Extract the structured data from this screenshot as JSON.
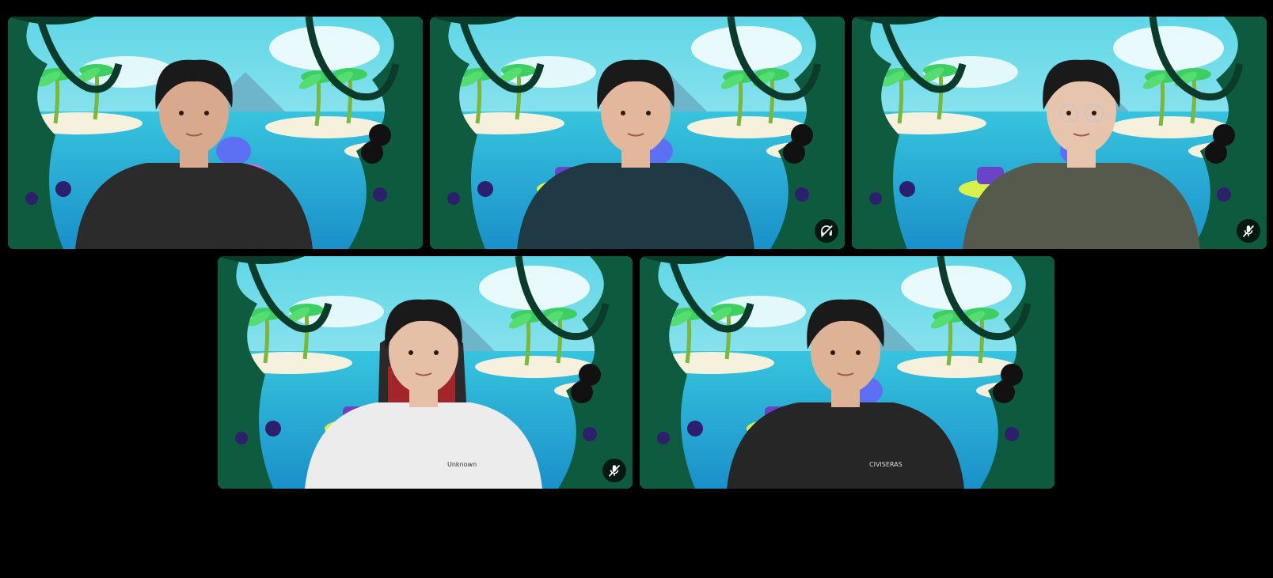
{
  "call": {
    "tiles": [
      {
        "id": "p1",
        "speaking": true,
        "muted": false,
        "deafened": false,
        "shirt": "#2b2b2b",
        "skin": "#d8a98c",
        "chair": false,
        "shirt_text": ""
      },
      {
        "id": "p2",
        "speaking": false,
        "muted": false,
        "deafened": true,
        "shirt": "#1f3a44",
        "skin": "#e2b79b",
        "chair": false,
        "shirt_text": ""
      },
      {
        "id": "p3",
        "speaking": false,
        "muted": true,
        "deafened": false,
        "shirt": "#565a4c",
        "skin": "#e7c4ac",
        "chair": false,
        "shirt_text": ""
      },
      {
        "id": "p4",
        "speaking": false,
        "muted": true,
        "deafened": false,
        "shirt": "#ececec",
        "skin": "#e6c0a6",
        "chair": true,
        "shirt_text": "Unknown"
      },
      {
        "id": "p5",
        "speaking": false,
        "muted": false,
        "deafened": false,
        "shirt": "#262626",
        "skin": "#ddb295",
        "chair": false,
        "shirt_text": "CIVISERAS"
      }
    ],
    "icons": {
      "muted": "mic-off-icon",
      "deafened": "headphones-off-icon"
    },
    "colors": {
      "speaking_ring": "#3ba55d",
      "background": "#000000"
    }
  }
}
